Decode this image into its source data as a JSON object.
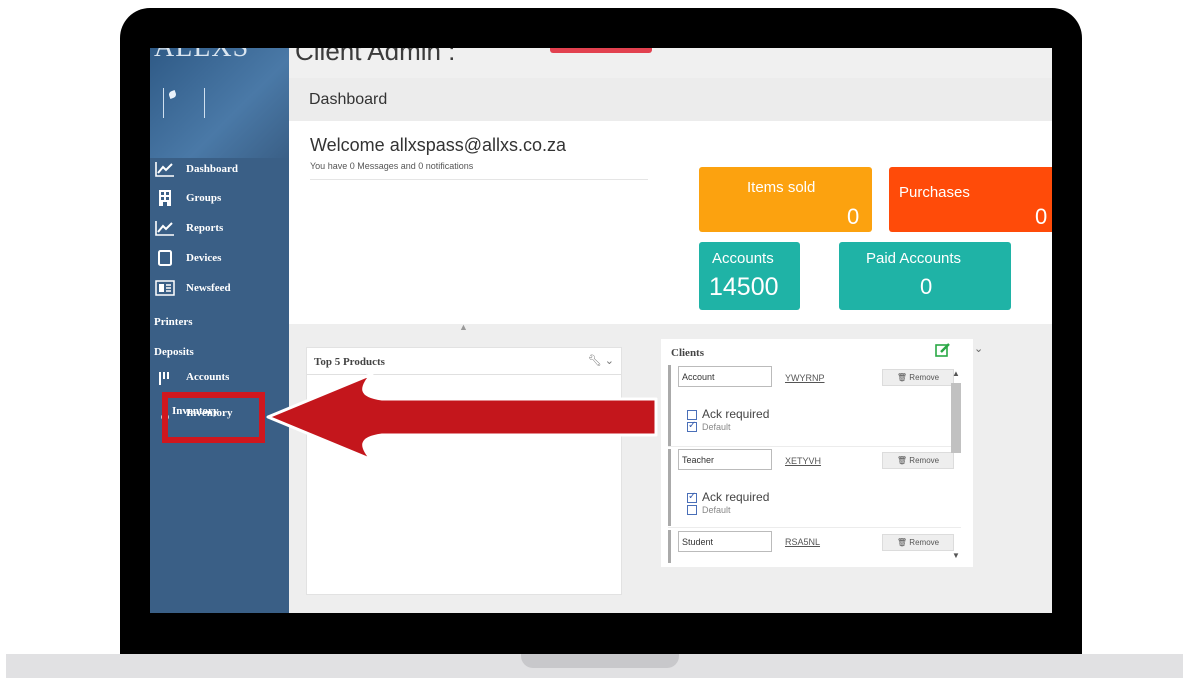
{
  "app": {
    "logo": "ALLXS",
    "header_title": "Client Admin :",
    "breadcrumb": "Dashboard"
  },
  "sidebar": {
    "items": [
      {
        "label": "Dashboard",
        "icon": "line-chart-icon"
      },
      {
        "label": "Groups",
        "icon": "building-icon"
      },
      {
        "label": "Reports",
        "icon": "line-chart-icon"
      },
      {
        "label": "Devices",
        "icon": "tablet-icon"
      },
      {
        "label": "Newsfeed",
        "icon": "newspaper-icon"
      },
      {
        "label": "Printers",
        "icon": ""
      },
      {
        "label": "Deposits",
        "icon": ""
      },
      {
        "label": "Accounts",
        "icon": "cutlery-icon"
      },
      {
        "label": "Inventory",
        "icon": "link-icon"
      }
    ]
  },
  "welcome": {
    "title": "Welcome allxspass@allxs.co.za",
    "subtitle": "You have 0 Messages and 0 notifications"
  },
  "stats": [
    {
      "label": "Items sold",
      "value": "0",
      "color": "#fca20f"
    },
    {
      "label": "Purchases",
      "value": "0",
      "color": "#ff4b09"
    },
    {
      "label": "Accounts",
      "value": "14500",
      "color": "#1fb3a6"
    },
    {
      "label": "Paid Accounts",
      "value": "0",
      "color": "#1fb3a6"
    }
  ],
  "top_products": {
    "title": "Top 5 Products"
  },
  "clients": {
    "title": "Clients",
    "rows": [
      {
        "name": "Account",
        "code": "YWYRNP",
        "remove_label": "Remove",
        "ack_label": "Ack required",
        "ack_checked": false,
        "default_label": "Default",
        "default_checked": true
      },
      {
        "name": "Teacher",
        "code": "XETYVH",
        "remove_label": "Remove",
        "ack_label": "Ack required",
        "ack_checked": true,
        "default_label": "Default",
        "default_checked": false
      },
      {
        "name": "Student",
        "code": "RSA5NL",
        "remove_label": "Remove"
      }
    ]
  },
  "callout": {
    "label": "Inventory",
    "color": "#d0171e"
  }
}
